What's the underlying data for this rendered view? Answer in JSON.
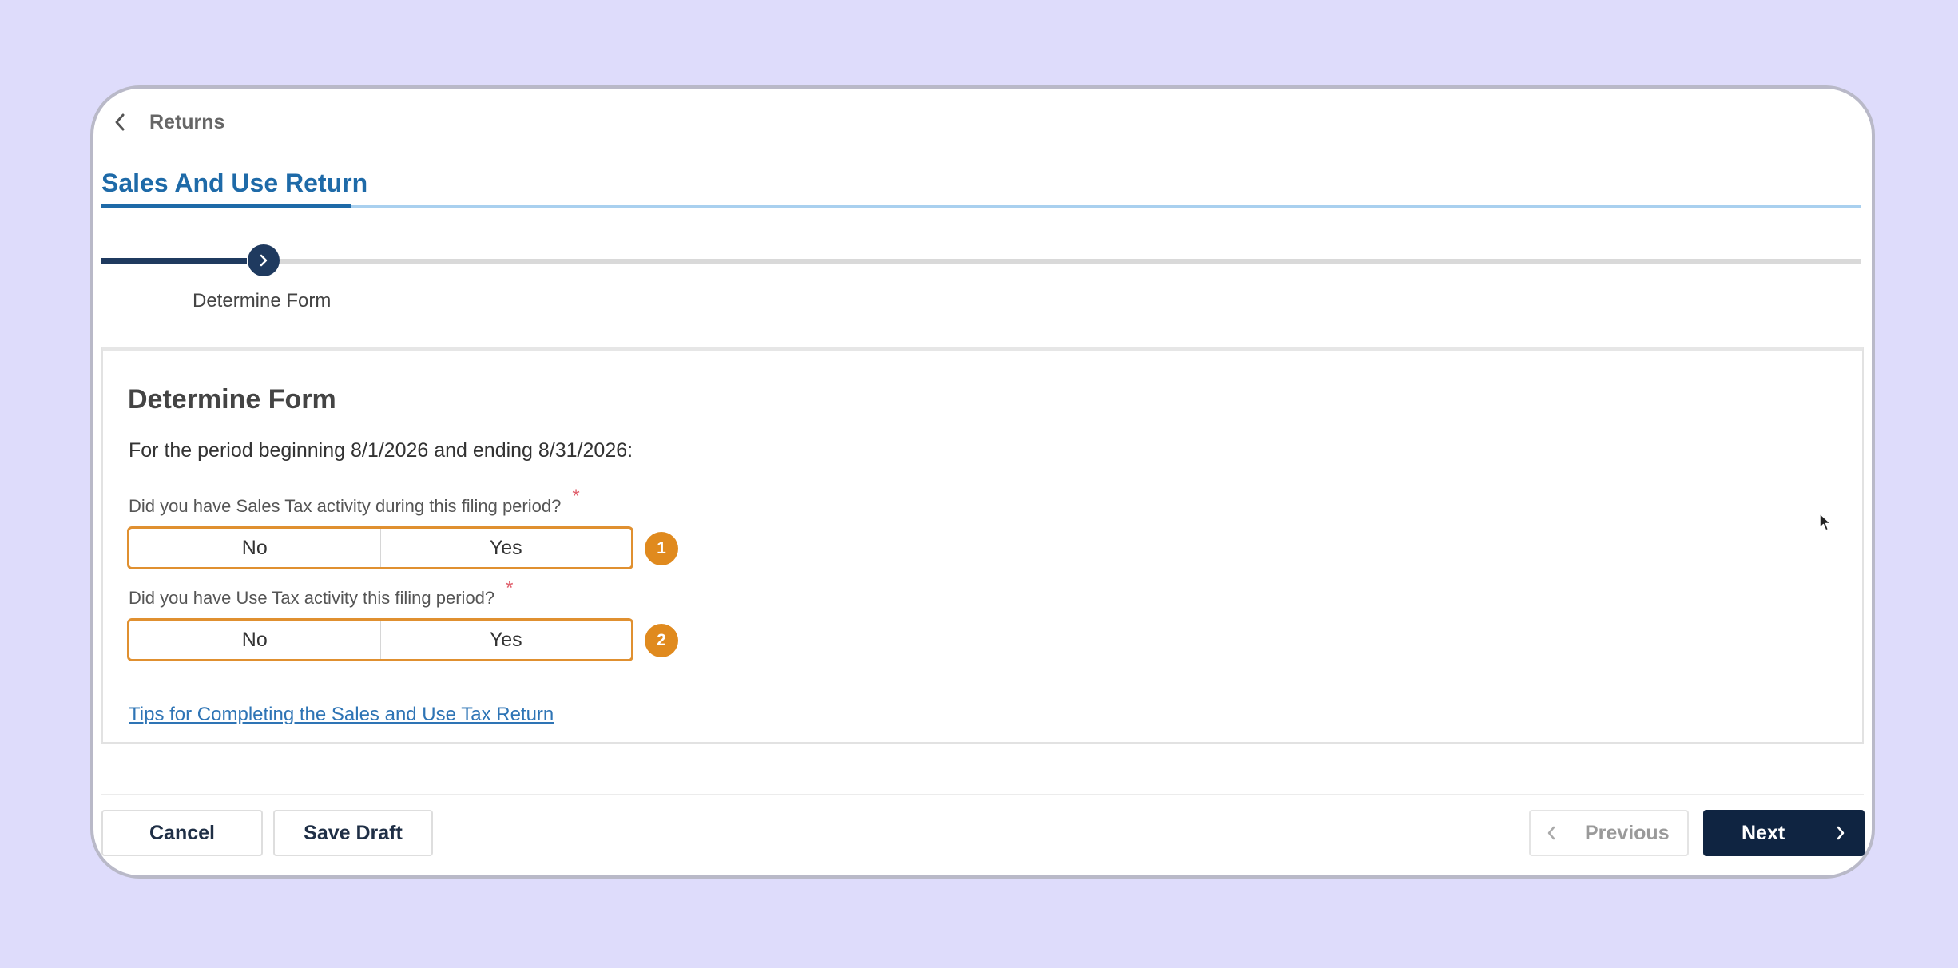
{
  "header": {
    "back_label": "Returns",
    "tab_title": "Sales And Use Return"
  },
  "progress": {
    "current_step": "Determine Form"
  },
  "form": {
    "title": "Determine Form",
    "period_text": "For the period beginning 8/1/2026 and ending 8/31/2026:",
    "questions": [
      {
        "label": "Did you have Sales Tax activity during this filing period?",
        "required_mark": "*",
        "options": [
          "No",
          "Yes"
        ],
        "badge": "1"
      },
      {
        "label": "Did you have Use Tax activity this filing period?",
        "required_mark": "*",
        "options": [
          "No",
          "Yes"
        ],
        "badge": "2"
      }
    ],
    "tips_link": "Tips for Completing the Sales and Use Tax Return"
  },
  "footer": {
    "cancel_label": "Cancel",
    "save_draft_label": "Save Draft",
    "previous_label": "Previous",
    "next_label": "Next"
  },
  "colors": {
    "accent_blue": "#1e6aa8",
    "navy": "#0f2441",
    "highlight_orange": "#e08a1e",
    "required_red": "#e0626e"
  },
  "icons": {
    "back": "chevron-left-icon",
    "step": "chevron-right-icon",
    "previous": "chevron-left-icon",
    "next": "chevron-right-icon",
    "cursor": "mouse-pointer-icon"
  }
}
